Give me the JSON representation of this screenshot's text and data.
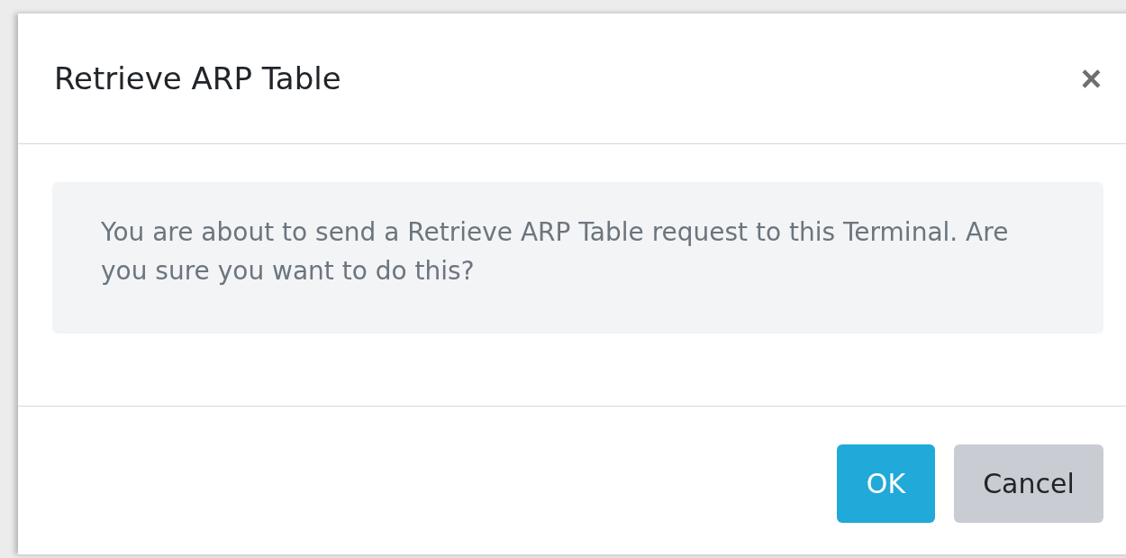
{
  "dialog": {
    "title": "Retrieve ARP Table",
    "close": "×",
    "message": "You are about to send a Retrieve ARP Table request to this Terminal. Are you sure you want to do this?",
    "buttons": [
      {
        "label": "OK",
        "kind": "primary"
      },
      {
        "label": "Cancel",
        "kind": "secondary"
      }
    ]
  }
}
